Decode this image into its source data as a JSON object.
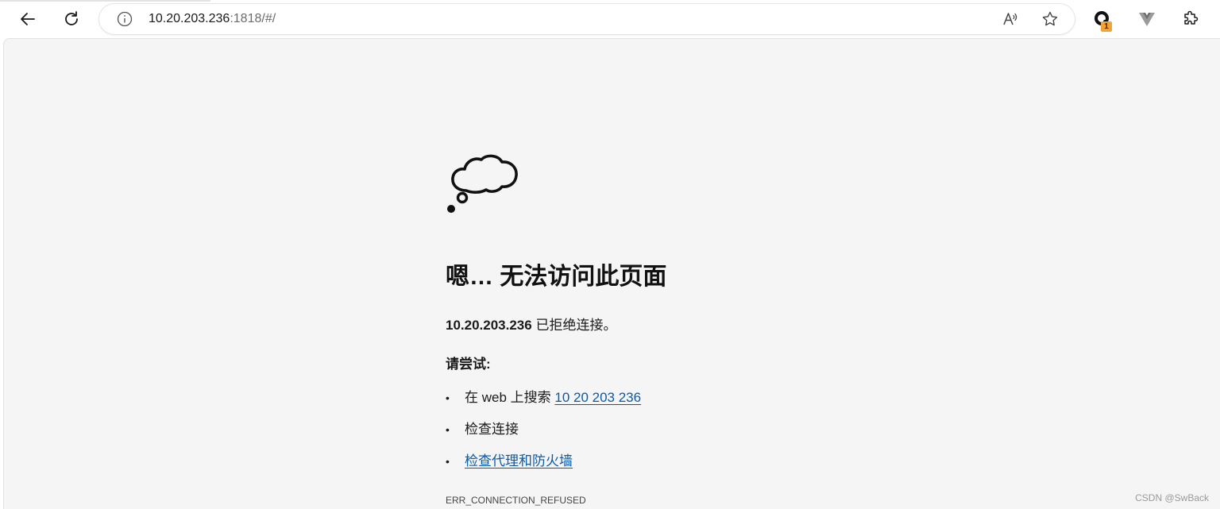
{
  "address_bar": {
    "url_host": "10.20.203.236",
    "url_rest": ":1818/#/"
  },
  "toolbar": {
    "icons": [
      "back-icon",
      "refresh-icon",
      "info-icon",
      "read-aloud-icon",
      "favorite-star-icon",
      "extension-badge-icon",
      "vue-devtools-icon",
      "extensions-puzzle-icon"
    ],
    "extension_badge_count": "1",
    "accent_badge_color": "#f2a23b"
  },
  "error_page": {
    "icon": "thought-cloud-icon",
    "title": "嗯… 无法访问此页面",
    "host": "10.20.203.236",
    "message_suffix": "已拒绝连接。",
    "try_heading": "请尝试:",
    "suggestions": [
      {
        "prefix": "在 web 上搜索",
        "link": "10 20 203 236"
      },
      {
        "text": "检查连接"
      },
      {
        "link": "检查代理和防火墙"
      }
    ],
    "error_code": "ERR_CONNECTION_REFUSED",
    "link_color": "#0a5aa8"
  },
  "watermark": "CSDN @SwBack"
}
